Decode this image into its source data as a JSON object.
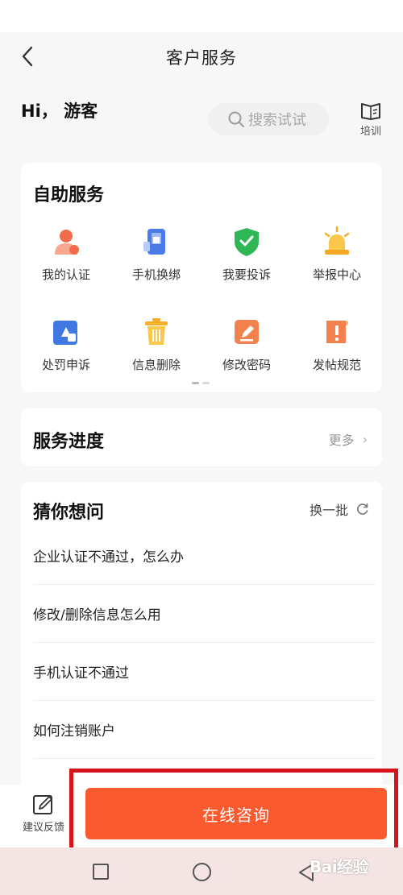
{
  "header": {
    "title": "客户服务"
  },
  "greeting": "Hi， 游客",
  "search": {
    "placeholder": "搜索试试"
  },
  "training": {
    "label": "培训"
  },
  "self_service": {
    "title": "自助服务",
    "items": [
      {
        "label": "我的认证",
        "icon": "user-verify-icon"
      },
      {
        "label": "手机换绑",
        "icon": "phone-rebind-icon"
      },
      {
        "label": "我要投诉",
        "icon": "complaint-shield-icon"
      },
      {
        "label": "举报中心",
        "icon": "report-alarm-icon"
      },
      {
        "label": "处罚申诉",
        "icon": "penalty-appeal-icon"
      },
      {
        "label": "信息删除",
        "icon": "trash-icon"
      },
      {
        "label": "修改密码",
        "icon": "edit-password-icon"
      },
      {
        "label": "发帖规范",
        "icon": "posting-rules-icon"
      }
    ]
  },
  "progress": {
    "title": "服务进度",
    "more": "更多"
  },
  "guess": {
    "title": "猜你想问",
    "refresh": "换一批",
    "questions": [
      "企业认证不通过，怎么办",
      "修改/删除信息怎么用",
      "手机认证不通过",
      "如何注销账户"
    ]
  },
  "footer": {
    "feedback": "建议反馈",
    "consult": "在线咨询"
  },
  "watermark": "Bai经验",
  "colors": {
    "accent": "#fb5a2e",
    "highlight_frame": "#d6131c",
    "page_bg": "#f7f7f7",
    "navbar_bg": "#f5e4e4"
  }
}
